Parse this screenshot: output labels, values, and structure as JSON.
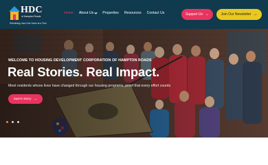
{
  "header": {
    "logo": {
      "word": "HDC",
      "sub": "of Hampton Roads",
      "tagline": "Rebuilding Lives One Home at a Time"
    },
    "nav": [
      {
        "label": "Home",
        "active": true
      },
      {
        "label": "About Us",
        "dropdown": true
      },
      {
        "label": "Properties"
      },
      {
        "label": "Resources"
      },
      {
        "label": "Contact Us"
      }
    ],
    "support_label": "Support Us",
    "newsletter_label": "Join Our Newsletter"
  },
  "hero": {
    "eyebrow": "WELCOME TO HOUSING DEVELOPMENT CORPORATION OF HAMPTON ROADS",
    "headline": "Real Stories. Real Impact.",
    "subline": "Meet residents whose lives have changed through our housing programs, proof that every effort counts",
    "cta_label": "Sam's Story",
    "slides_total": 3,
    "active_slide": 1
  },
  "colors": {
    "header_bg": "#103a4d",
    "accent_pink": "#e8345f",
    "accent_yellow": "#e9c81f",
    "dot_active": "#e8903a"
  },
  "icons": {
    "arrow": "arrow-right-icon",
    "chevron": "chevron-down-icon"
  }
}
